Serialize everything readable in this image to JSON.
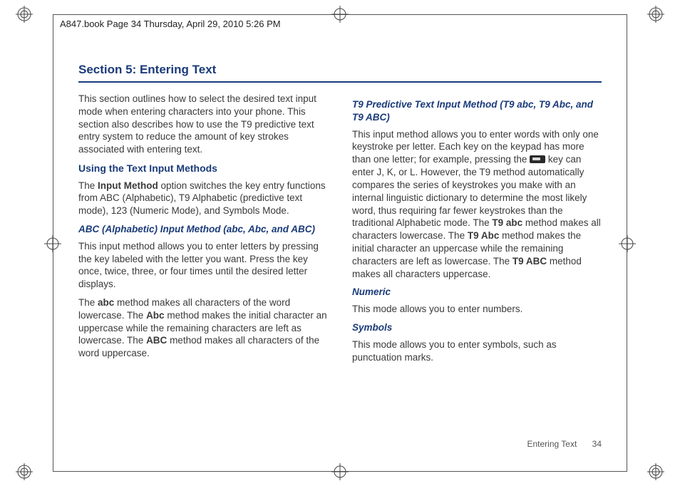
{
  "header": {
    "doc_info": "A847.book  Page 34  Thursday, April 29, 2010  5:26 PM"
  },
  "title": "Section 5: Entering Text",
  "left": {
    "intro": "This section outlines how to select the desired text input mode when entering characters into your phone. This section also describes how to use the T9 predictive text entry system to reduce the amount of key strokes associated with entering text.",
    "h2a": "Using the Text Input Methods",
    "p2a": "The ",
    "p2a_bold": "Input Method",
    "p2a_tail": " option switches the key entry functions from ABC (Alphabetic), T9 Alphabetic (predictive text mode), 123 (Numeric Mode), and Symbols Mode.",
    "h3a": "ABC (Alphabetic) Input Method (abc, Abc, and ABC)",
    "p3": "This input method allows you to enter letters by pressing the key labeled with the letter you want. Press the key once, twice, three, or four times until the desired letter displays.",
    "p4a": "The ",
    "p4_abc": "abc",
    "p4b": " method makes all characters of the word lowercase. The ",
    "p4_Abc": "Abc",
    "p4c": " method makes the initial character an uppercase while the remaining characters are left as lowercase. The ",
    "p4_ABC": "ABC",
    "p4d": " method makes all characters of the word uppercase."
  },
  "right": {
    "h3a": "T9 Predictive Text Input Method (T9 abc, T9 Abc, and T9 ABC)",
    "p1a": "This input method allows you to enter words with only one keystroke per letter. Each key on the keypad has more than one letter; for example, pressing the ",
    "p1b": " key can enter J, K, or L. However, the T9 method automatically compares the series of keystrokes you make with an internal linguistic dictionary to determine the most likely word, thus requiring far fewer keystrokes than the traditional Alphabetic mode. The ",
    "p1_t9abc": "T9 abc",
    "p1c": " method makes all characters lowercase. The ",
    "p1_t9Abc": "T9 Abc",
    "p1d": " method makes the initial character an uppercase while the remaining characters are left as lowercase. The ",
    "p1_t9ABC": "T9 ABC",
    "p1e": " method makes all characters uppercase.",
    "h3b": "Numeric",
    "p2": "This mode allows you to enter numbers.",
    "h3c": "Symbols",
    "p3": "This mode allows you to enter symbols, such as punctuation marks."
  },
  "footer": {
    "section": "Entering Text",
    "page": "34"
  }
}
